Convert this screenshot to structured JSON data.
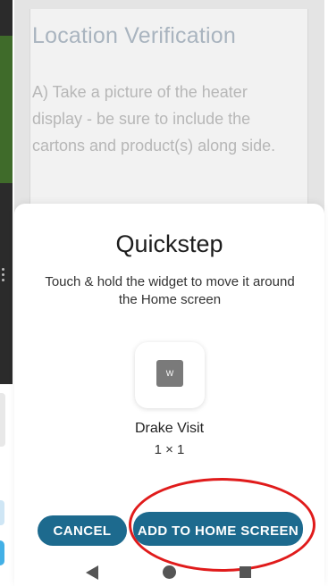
{
  "background_app": {
    "title": "Location Verification",
    "instruction": "A) Take a picture of the heater display - be sure to include the cartons and product(s) along side."
  },
  "sheet": {
    "title": "Quickstep",
    "subtitle": "Touch & hold the widget to move it around the Home screen",
    "widget": {
      "icon_letter": "W",
      "icon_semantic": "widget-app-icon",
      "name": "Drake Visit",
      "size": "1 × 1"
    },
    "cancel_label": "CANCEL",
    "add_label": "ADD TO HOME SCREEN"
  },
  "annotation": {
    "color": "#e01b1b"
  },
  "nav": {
    "back": "back-icon",
    "home": "home-icon",
    "recents": "recents-icon"
  },
  "colors": {
    "accent": "#1d6a8e",
    "muted_title": "#a9b4bf"
  }
}
